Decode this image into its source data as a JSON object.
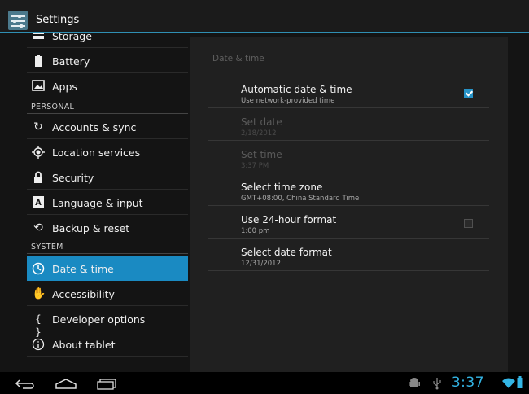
{
  "app": {
    "title": "Settings"
  },
  "sidebar": {
    "items": [
      {
        "label": "Storage",
        "icon": "storage-icon"
      },
      {
        "label": "Battery",
        "icon": "battery-icon"
      },
      {
        "label": "Apps",
        "icon": "apps-icon"
      }
    ],
    "personal_header": "PERSONAL",
    "personal_items": [
      {
        "label": "Accounts & sync",
        "icon": "sync-icon"
      },
      {
        "label": "Location services",
        "icon": "location-icon"
      },
      {
        "label": "Security",
        "icon": "lock-icon"
      },
      {
        "label": "Language & input",
        "icon": "keyboard-icon"
      },
      {
        "label": "Backup & reset",
        "icon": "restore-icon"
      }
    ],
    "system_header": "SYSTEM",
    "system_items": [
      {
        "label": "Date & time",
        "icon": "clock-icon",
        "selected": true
      },
      {
        "label": "Accessibility",
        "icon": "hand-icon"
      },
      {
        "label": "Developer options",
        "icon": "braces-icon"
      },
      {
        "label": "About tablet",
        "icon": "info-icon"
      }
    ]
  },
  "detail": {
    "title": "Date & time",
    "prefs": [
      {
        "title": "Automatic date & time",
        "summary": "Use network-provided time",
        "checkbox": true,
        "checked": true,
        "enabled": true
      },
      {
        "title": "Set date",
        "summary": "2/18/2012",
        "checkbox": false,
        "enabled": false
      },
      {
        "title": "Set time",
        "summary": "3:37 PM",
        "checkbox": false,
        "enabled": false
      },
      {
        "title": "Select time zone",
        "summary": "GMT+08:00, China Standard Time",
        "checkbox": false,
        "enabled": true
      },
      {
        "title": "Use 24-hour format",
        "summary": "1:00 pm",
        "checkbox": true,
        "checked": false,
        "enabled": true
      },
      {
        "title": "Select date format",
        "summary": "12/31/2012",
        "checkbox": false,
        "enabled": true
      }
    ]
  },
  "statusbar": {
    "time": "3:37"
  },
  "colors": {
    "accent": "#33b5e5",
    "selected": "#1a8ac2"
  }
}
